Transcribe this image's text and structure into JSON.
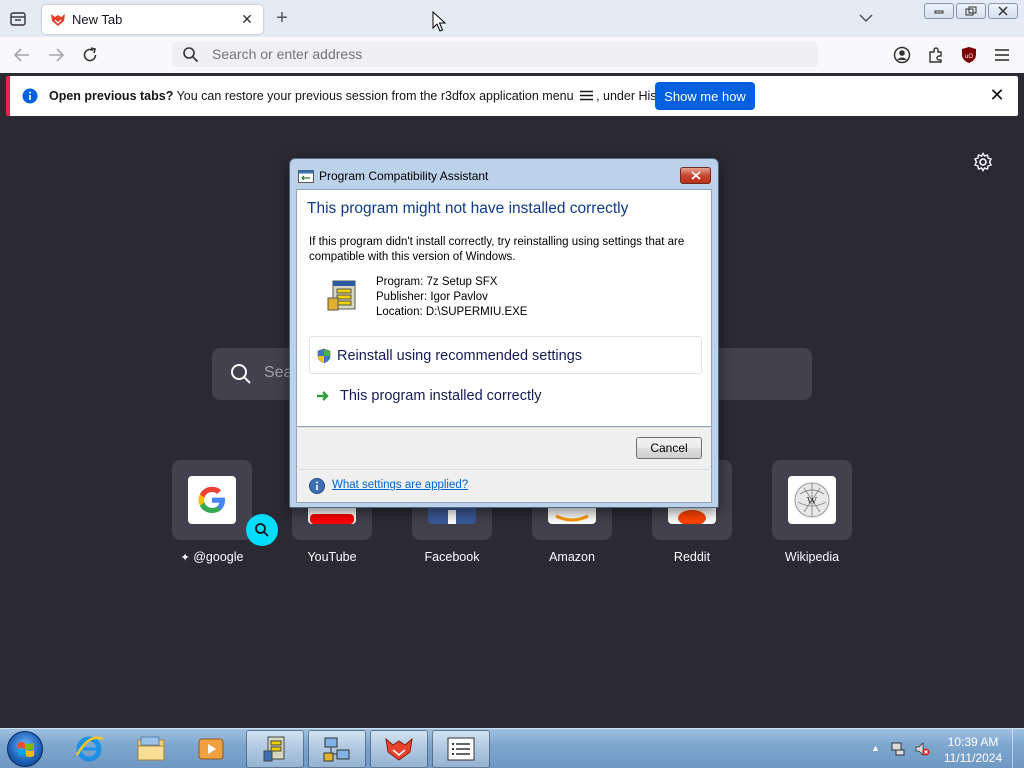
{
  "browser": {
    "tab_title": "New Tab",
    "url_placeholder": "Search or enter address",
    "notification": {
      "bold_text": "Open previous tabs?",
      "text_before_menu": "You can restore your previous session from the r3dfox application menu",
      "text_after_menu": ", under History.",
      "button_label": "Show me how"
    }
  },
  "newtab": {
    "search_placeholder": "Sea",
    "sites": [
      {
        "label": "@google"
      },
      {
        "label": "YouTube"
      },
      {
        "label": "Facebook"
      },
      {
        "label": "Amazon"
      },
      {
        "label": "Reddit"
      },
      {
        "label": "Wikipedia"
      }
    ]
  },
  "dialog": {
    "title": "Program Compatibility Assistant",
    "heading": "This program might not have installed correctly",
    "description": "If this program didn't install correctly, try reinstalling using settings that are compatible with this version of Windows.",
    "program": "Program: 7z Setup SFX",
    "publisher": "Publisher: Igor Pavlov",
    "location": "Location: D:\\SUPERMIU.EXE",
    "option1": "Reinstall using recommended settings",
    "option2": "This program installed correctly",
    "cancel_label": "Cancel",
    "help_link": "What settings are applied?"
  },
  "taskbar": {
    "time": "10:39 AM",
    "date": "11/11/2024"
  },
  "colors": {
    "accent_button": "#0061e0",
    "notif_stripe": "#e22850",
    "newtab_bg": "#2b2a33",
    "dialog_heading": "#0c3c89"
  }
}
